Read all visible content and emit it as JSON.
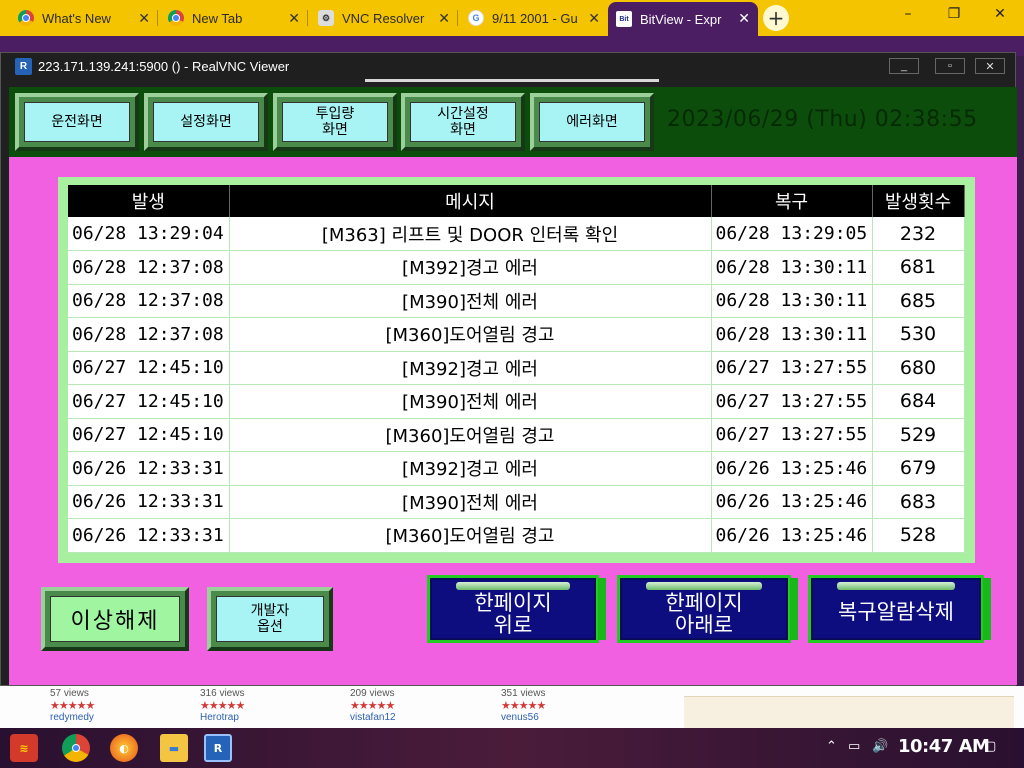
{
  "browser": {
    "tabs": [
      {
        "title": "What's New",
        "icon": "chrome-icon"
      },
      {
        "title": "New Tab",
        "icon": "chrome-icon"
      },
      {
        "title": "VNC Resolver",
        "icon": "vnc-icon"
      },
      {
        "title": "9/11 2001 - Gu",
        "icon": "google-icon"
      },
      {
        "title": "BitView - Expr",
        "icon": "bitview-icon",
        "active": true
      }
    ],
    "new_tab_label": "+"
  },
  "vnc": {
    "title": "223.171.139.241:5900 () - RealVNC Viewer",
    "icon_text": "R"
  },
  "hmi": {
    "nav": [
      {
        "label": "운전화면"
      },
      {
        "label": "설정화면"
      },
      {
        "label": "투입량\n화면"
      },
      {
        "label": "시간설정\n화면"
      },
      {
        "label": "에러화면"
      }
    ],
    "datetime": "2023/06/29 (Thu) 02:38:55",
    "table": {
      "headers": [
        "발생",
        "메시지",
        "복구",
        "발생횟수"
      ],
      "rows": [
        {
          "occurred": "06/28 13:29:04",
          "message": "[M363] 리프트 및 DOOR 인터록 확인",
          "recovered": "06/28 13:29:05",
          "count": "232"
        },
        {
          "occurred": "06/28 12:37:08",
          "message": "[M392]경고 에러",
          "recovered": "06/28 13:30:11",
          "count": "681"
        },
        {
          "occurred": "06/28 12:37:08",
          "message": "[M390]전체 에러",
          "recovered": "06/28 13:30:11",
          "count": "685"
        },
        {
          "occurred": "06/28 12:37:08",
          "message": "[M360]도어열림 경고",
          "recovered": "06/28 13:30:11",
          "count": "530"
        },
        {
          "occurred": "06/27 12:45:10",
          "message": "[M392]경고 에러",
          "recovered": "06/27 13:27:55",
          "count": "680"
        },
        {
          "occurred": "06/27 12:45:10",
          "message": "[M390]전체 에러",
          "recovered": "06/27 13:27:55",
          "count": "684"
        },
        {
          "occurred": "06/27 12:45:10",
          "message": "[M360]도어열림 경고",
          "recovered": "06/27 13:27:55",
          "count": "529"
        },
        {
          "occurred": "06/26 12:33:31",
          "message": "[M392]경고 에러",
          "recovered": "06/26 13:25:46",
          "count": "679"
        },
        {
          "occurred": "06/26 12:33:31",
          "message": "[M390]전체 에러",
          "recovered": "06/26 13:25:46",
          "count": "683"
        },
        {
          "occurred": "06/26 12:33:31",
          "message": "[M360]도어열림 경고",
          "recovered": "06/26 13:25:46",
          "count": "528"
        }
      ]
    },
    "buttons": {
      "clear_fault": "이상해제",
      "dev_options": "개발자\n옵션",
      "page_up": "한페이지\n위로",
      "page_down": "한페이지\n아래로",
      "delete_recovered": "복구알람삭제"
    },
    "colors": {
      "background": "#f060e0",
      "header": "#0c4d0c",
      "nav_face": "#a8f4f4",
      "table_frame": "#a8f0a0",
      "blue_button": "#0d0d80"
    }
  },
  "behind_page": {
    "cards": [
      {
        "views": "57 views",
        "stars": "★★★★★",
        "user": "redymedy"
      },
      {
        "views": "316 views",
        "stars": "★★★★★",
        "user": "Herotrap"
      },
      {
        "views": "209 views",
        "stars": "★★★★★",
        "user": "vistafan12"
      },
      {
        "views": "351 views",
        "stars": "★★★★★",
        "user": "venus56"
      }
    ]
  },
  "taskbar": {
    "clock": "10:47 AM",
    "apps": [
      "start-icon",
      "chrome-icon",
      "firefox-icon",
      "file-explorer-icon",
      "realvnc-icon"
    ]
  }
}
